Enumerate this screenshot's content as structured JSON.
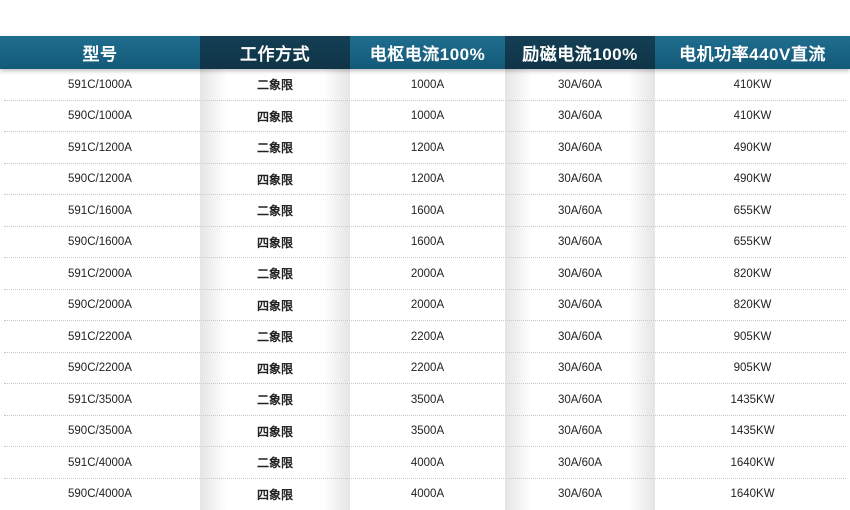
{
  "table": {
    "headers": [
      "型号",
      "工作方式",
      "电枢电流100%",
      "励磁电流100%",
      "电机功率440V直流"
    ],
    "rows": [
      [
        "591C/1000A",
        "二象限",
        "1000A",
        "30A/60A",
        "410KW"
      ],
      [
        "590C/1000A",
        "四象限",
        "1000A",
        "30A/60A",
        "410KW"
      ],
      [
        "591C/1200A",
        "二象限",
        "1200A",
        "30A/60A",
        "490KW"
      ],
      [
        "590C/1200A",
        "四象限",
        "1200A",
        "30A/60A",
        "490KW"
      ],
      [
        "591C/1600A",
        "二象限",
        "1600A",
        "30A/60A",
        "655KW"
      ],
      [
        "590C/1600A",
        "四象限",
        "1600A",
        "30A/60A",
        "655KW"
      ],
      [
        "591C/2000A",
        "二象限",
        "2000A",
        "30A/60A",
        "820KW"
      ],
      [
        "590C/2000A",
        "四象限",
        "2000A",
        "30A/60A",
        "820KW"
      ],
      [
        "591C/2200A",
        "二象限",
        "2200A",
        "30A/60A",
        "905KW"
      ],
      [
        "590C/2200A",
        "四象限",
        "2200A",
        "30A/60A",
        "905KW"
      ],
      [
        "591C/3500A",
        "二象限",
        "3500A",
        "30A/60A",
        "1435KW"
      ],
      [
        "590C/3500A",
        "四象限",
        "3500A",
        "30A/60A",
        "1435KW"
      ],
      [
        "591C/4000A",
        "二象限",
        "4000A",
        "30A/60A",
        "1640KW"
      ],
      [
        "590C/4000A",
        "四象限",
        "4000A",
        "30A/60A",
        "1640KW"
      ]
    ]
  },
  "colors": {
    "header_bg": "#1a6686",
    "header_dark": "#123d52",
    "header_text": "#ffffff",
    "body_text": "#222222"
  }
}
